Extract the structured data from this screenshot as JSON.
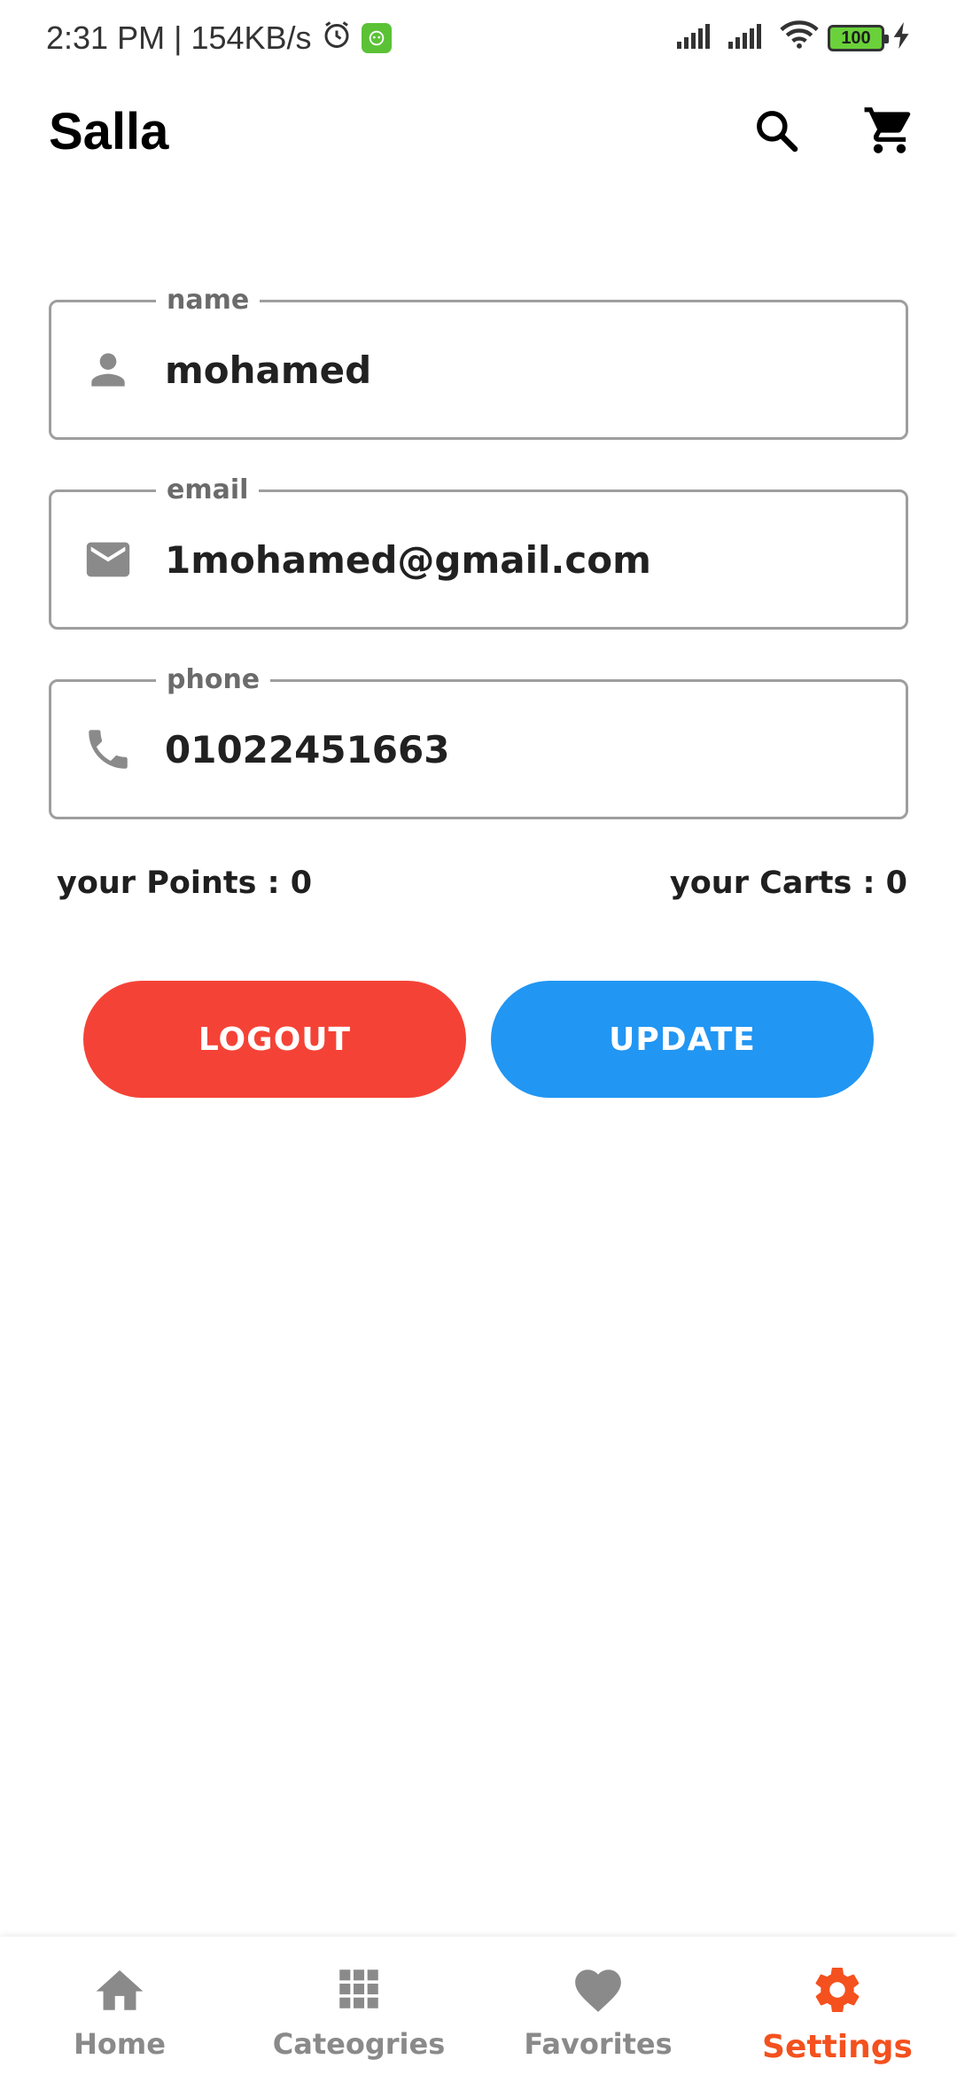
{
  "status_bar": {
    "time": "2:31 PM",
    "speed": "154KB/s",
    "battery": "100"
  },
  "app_bar": {
    "title": "Salla",
    "icons": [
      "search-icon",
      "cart-icon"
    ]
  },
  "form": {
    "name": {
      "label": "name",
      "value": "mohamed",
      "icon": "person-icon"
    },
    "email": {
      "label": "email",
      "value": "1mohamed@gmail.com",
      "icon": "mail-icon"
    },
    "phone": {
      "label": "phone",
      "value": "01022451663",
      "icon": "phone-icon"
    }
  },
  "stats": {
    "points": "your Points : 0",
    "carts": "your Carts : 0"
  },
  "buttons": {
    "logout": "LOGOUT",
    "update": "UPDATE"
  },
  "bottom_nav": {
    "items": [
      {
        "label": "Home",
        "icon": "home-icon"
      },
      {
        "label": "Cateogries",
        "icon": "grid-icon"
      },
      {
        "label": "Favorites",
        "icon": "heart-icon"
      },
      {
        "label": "Settings",
        "icon": "gear-icon",
        "active": true
      }
    ]
  },
  "colors": {
    "logout": "#f44336",
    "update": "#2196f3",
    "active_nav": "#f4511e",
    "inactive_nav": "#8a8a8a"
  }
}
